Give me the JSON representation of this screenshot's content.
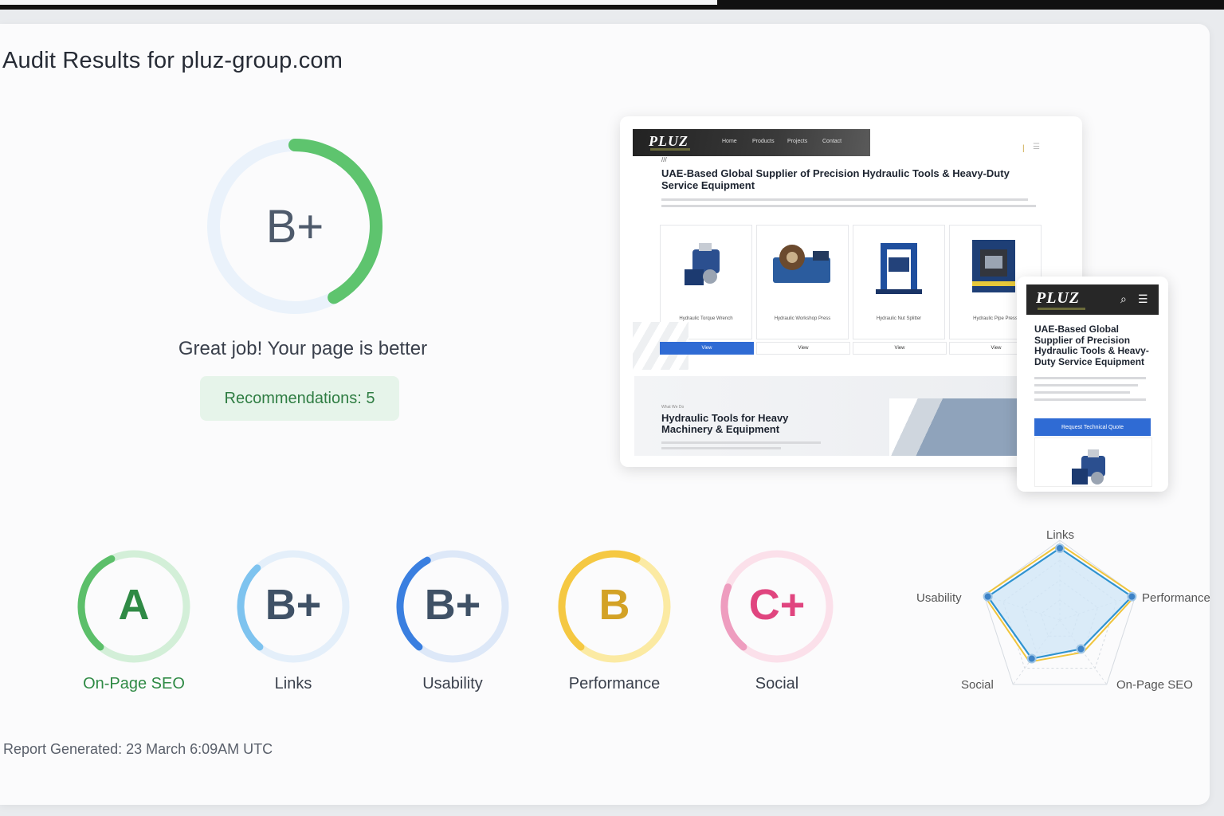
{
  "page": {
    "title": "Audit Results for pluz-group.com",
    "footer": "Report Generated: 23 March 6:09AM UTC"
  },
  "overall": {
    "grade": "B+",
    "score_fraction": 0.42,
    "message": "Great job! Your page is better",
    "recommendations": "Recommendations: 5"
  },
  "preview": {
    "desktop": {
      "logo": "PLUZ",
      "nav": [
        "Home",
        "Products",
        "Projects",
        "Contact"
      ],
      "headline": "UAE-Based Global Supplier of Precision Hydraulic Tools & Heavy-Duty Service Equipment",
      "products": [
        {
          "label": "Hydraulic Torque Wrench",
          "button": "View"
        },
        {
          "label": "Hydraulic Workshop Press",
          "button": "View"
        },
        {
          "label": "Hydraulic Nut Splitter",
          "button": "View"
        },
        {
          "label": "Hydraulic Pipe Press",
          "button": "View"
        }
      ],
      "band_small": "What We Do",
      "band_title": "Hydraulic Tools for Heavy Machinery & Equipment"
    },
    "mobile": {
      "logo": "PLUZ",
      "headline": "UAE-Based Global Supplier of Precision Hydraulic Tools & Heavy-Duty Service Equipment",
      "cta": "Request Technical Quote"
    }
  },
  "categories": [
    {
      "name": "On-Page SEO",
      "grade": "A",
      "fraction": 0.32,
      "color": "#5cbf6a",
      "track": "#d3efd8",
      "text": "#2f8a45",
      "label_color": "#2f8a45"
    },
    {
      "name": "Links",
      "grade": "B+",
      "fraction": 0.27,
      "color": "#7ec3ef",
      "track": "#e4effa",
      "text": "#3f5166",
      "label_color": "#3a404c"
    },
    {
      "name": "Usability",
      "grade": "B+",
      "fraction": 0.31,
      "color": "#3a7fe0",
      "track": "#dde8f8",
      "text": "#3f5166",
      "label_color": "#3a404c"
    },
    {
      "name": "Performance",
      "grade": "B",
      "fraction": 0.46,
      "color": "#f5c842",
      "track": "#fbeaa3",
      "text": "#d3a226",
      "label_color": "#3a404c"
    },
    {
      "name": "Social",
      "grade": "C+",
      "fraction": 0.2,
      "color": "#ee9dbf",
      "track": "#fbe0ea",
      "text": "#e0457f",
      "label_color": "#3a404c"
    }
  ],
  "radar": {
    "labels": [
      "Links",
      "Performance",
      "On-Page SEO",
      "Social",
      "Usability"
    ],
    "values": [
      0.9,
      0.95,
      0.45,
      0.6,
      0.95
    ],
    "line_color": "#2f93d0",
    "fill_color": "#cfe6f7",
    "accent_color": "#f0c53c"
  }
}
